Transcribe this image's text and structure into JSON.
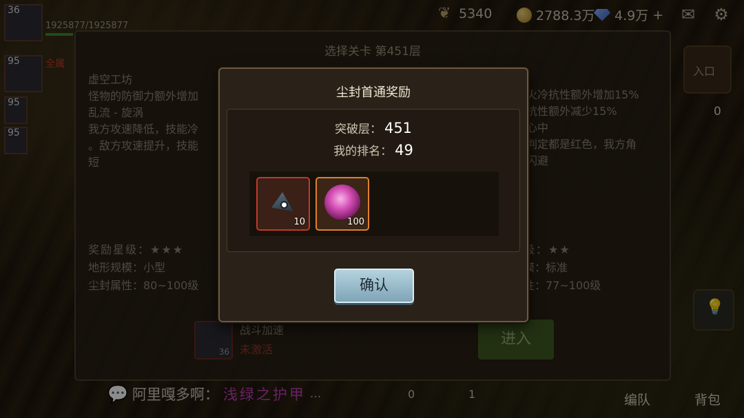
{
  "topbar": {
    "stamina": "5340",
    "gold": "2788.3万",
    "gems": "4.9万",
    "add_symbol": "+",
    "icons": [
      "leaf-icon",
      "gold-coin-icon",
      "gem-icon",
      "mail-icon",
      "gear-icon"
    ]
  },
  "heroes": {
    "hero_levels": [
      "36",
      "95",
      "95",
      "95"
    ],
    "hp_text": "1925877/1925877",
    "hero_tag": "全属"
  },
  "panel": {
    "title": "选择关卡 第451层",
    "left_lines": [
      "虚空工坊",
      "怪物的防御力额外增加",
      "乱流 - 旋涡",
      "我方攻速降低，技能冷",
      "。敌方攻速提升，技能",
      "短"
    ],
    "right_lines": [
      "火冷抗性额外增加15%",
      "抗性额外减少15%",
      "心中",
      "判定都是红色，我方角",
      "闪避"
    ],
    "left_stats": [
      "奖励星级：★★★",
      "地形规模：小型",
      "尘封属性：80~100级"
    ],
    "right_stats": [
      "级：★★",
      "模：标准",
      "性：77~100级"
    ],
    "boost_label": "战斗加速",
    "boost_status": "未激活",
    "boost_count": "36",
    "enter_label": "进入"
  },
  "right_column": {
    "top_label": "入口",
    "count": "0",
    "formation_label": "编队",
    "bag_label": "背包"
  },
  "chat": {
    "name": "阿里嘎多啊：",
    "message": "浅绿之护甲",
    "ellipsis": "...",
    "count_a": "0",
    "count_b": "1"
  },
  "modal": {
    "title": "尘封首通奖励",
    "floor_label": "突破层：",
    "floor_value": "451",
    "rank_label": "我的排名：",
    "rank_value": "49",
    "rewards": [
      {
        "name": "shard",
        "count": "10",
        "rarity_color": "#c0392b"
      },
      {
        "name": "magic-orb",
        "count": "100",
        "rarity_color": "#e0822a"
      }
    ],
    "confirm_label": "确认"
  }
}
